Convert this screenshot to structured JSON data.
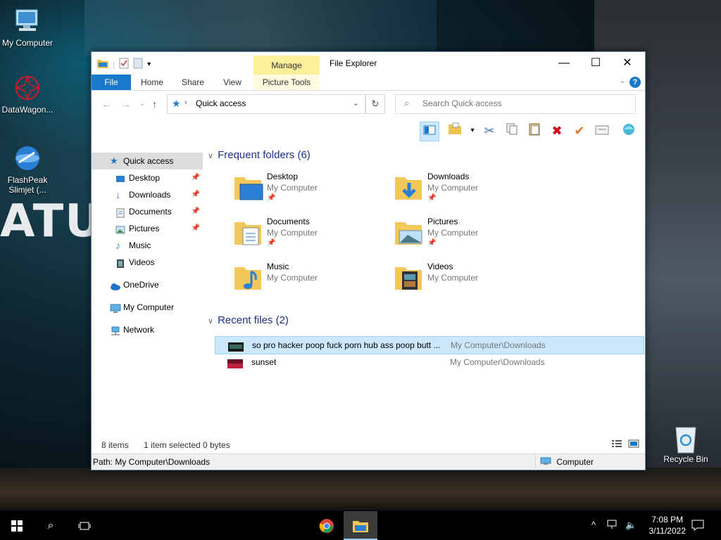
{
  "desktop": {
    "icons": [
      {
        "label": "My Computer"
      },
      {
        "label": "DataWagon..."
      },
      {
        "label": "FlashPeak Slimjet (..."
      },
      {
        "label": "Recycle Bin"
      }
    ],
    "wallpaper_text": "ATU"
  },
  "window": {
    "title": "File Explorer",
    "manage_tab": "Manage",
    "tabs": {
      "file": "File",
      "home": "Home",
      "share": "Share",
      "view": "View",
      "picture_tools": "Picture Tools"
    },
    "help": "?",
    "address": "Quick access",
    "search_placeholder": "Search Quick access"
  },
  "nav": {
    "items": [
      {
        "label": "Quick access"
      },
      {
        "label": "Desktop"
      },
      {
        "label": "Downloads"
      },
      {
        "label": "Documents"
      },
      {
        "label": "Pictures"
      },
      {
        "label": "Music"
      },
      {
        "label": "Videos"
      },
      {
        "label": "OneDrive"
      },
      {
        "label": "My Computer"
      },
      {
        "label": "Network"
      }
    ]
  },
  "frequent": {
    "header": "Frequent folders (6)",
    "folders": [
      {
        "name": "Desktop",
        "sub": "My Computer"
      },
      {
        "name": "Downloads",
        "sub": "My Computer"
      },
      {
        "name": "Documents",
        "sub": "My Computer"
      },
      {
        "name": "Pictures",
        "sub": "My Computer"
      },
      {
        "name": "Music",
        "sub": "My Computer"
      },
      {
        "name": "Videos",
        "sub": "My Computer"
      }
    ]
  },
  "recent": {
    "header": "Recent files (2)",
    "files": [
      {
        "name": "so pro hacker poop fuck porn hub ass poop butt ...",
        "path": "My Computer\\Downloads"
      },
      {
        "name": "sunset",
        "path": "My Computer\\Downloads"
      }
    ]
  },
  "status": {
    "items": "8 items",
    "selected": "1 item selected",
    "size": "0 bytes",
    "path": "Path: My Computer\\Downloads",
    "computer": "Computer"
  },
  "taskbar": {
    "time": "7:08 PM",
    "date": "3/11/2022"
  },
  "colors": {
    "accent": "#1979ca",
    "manage": "#fcf09c",
    "selection": "#cce8ff",
    "header_blue": "#1e3287"
  }
}
